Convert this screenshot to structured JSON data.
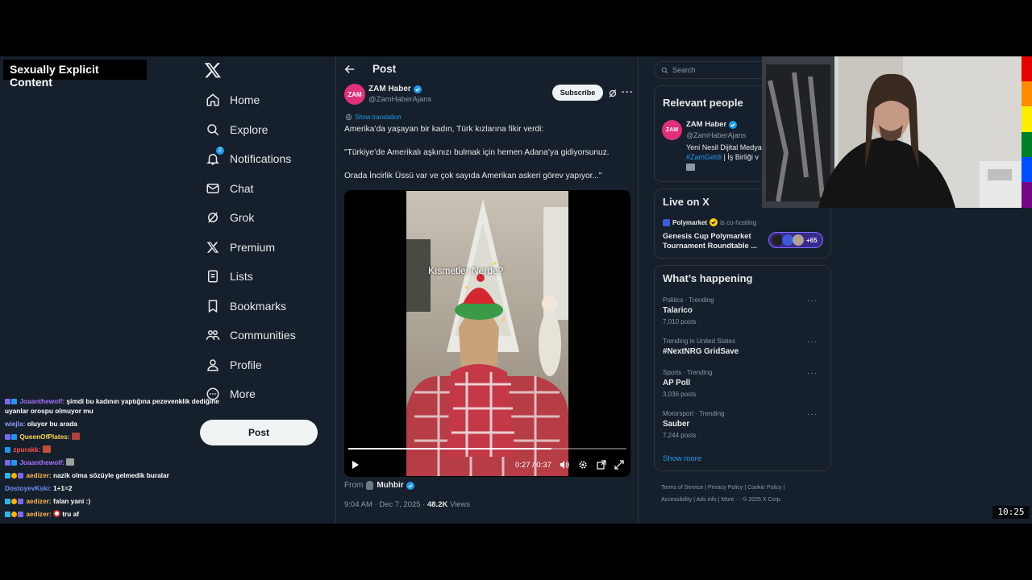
{
  "overlay": {
    "content_label": "Sexually Explicit Content"
  },
  "nav": {
    "items": [
      {
        "label": "Home",
        "icon": "home-icon"
      },
      {
        "label": "Explore",
        "icon": "search-icon"
      },
      {
        "label": "Notifications",
        "icon": "bell-icon",
        "badge": "2"
      },
      {
        "label": "Chat",
        "icon": "mail-icon"
      },
      {
        "label": "Grok",
        "icon": "grok-icon"
      },
      {
        "label": "Premium",
        "icon": "x-logo-icon"
      },
      {
        "label": "Lists",
        "icon": "list-icon"
      },
      {
        "label": "Bookmarks",
        "icon": "bookmark-icon"
      },
      {
        "label": "Communities",
        "icon": "communities-icon"
      },
      {
        "label": "Profile",
        "icon": "person-icon"
      },
      {
        "label": "More",
        "icon": "more-circle-icon"
      }
    ],
    "post_label": "Post"
  },
  "chat": [
    {
      "user": "Joaanthewolf:",
      "text": "şimdi bu kadının yaptığına pezevenklik dediğine uyanlar orospu olmuyor mu",
      "color": "#a970ff"
    },
    {
      "user": "wiejla:",
      "text": "oluyor bu arada",
      "color": "#8c9eff"
    },
    {
      "user": "QueenOfPlates:",
      "text": "",
      "color": "#ffd54f"
    },
    {
      "user": "zpurakk:",
      "text": "",
      "color": "#ff4d4d"
    },
    {
      "user": "Joaanthewolf:",
      "text": "",
      "color": "#a970ff"
    },
    {
      "user": "aedizer:",
      "text": "nazik olma sözüyle gelmedik buralar",
      "color": "#ffb74d"
    },
    {
      "user": "DostoyevKski:",
      "text": "1+1=2",
      "color": "#6f8dff"
    },
    {
      "user": "aedizer:",
      "text": "falan yani :)",
      "color": "#ffb74d"
    },
    {
      "user": "aedizer:",
      "text": "tru af",
      "color": "#ffb74d"
    }
  ],
  "post": {
    "header_title": "Post",
    "author_name": "ZAM Haber",
    "author_handle": "@ZamHaberAjans",
    "avatar_text": "ZAM",
    "subscribe_label": "Subscribe",
    "show_translation": "Show translation",
    "paragraphs": [
      "Amerika’da yaşayan bir kadın, Türk kızlarına  fikir verdi:",
      "\"Türkiye’de Amerikalı aşkınızı bulmak için hemen Adana’ya gidiyorsunuz.",
      "Orada İncirlik Üssü var ve çok sayıda Amerikan askeri görev yapıyor...\""
    ],
    "video": {
      "caption": "Kısmetler Nerde?",
      "time": "0:27 / 0:37",
      "progress": 0.73
    },
    "from_label": "From",
    "from_name": "Muhbir",
    "time": "9:04 AM · Dec 7, 2025 · ",
    "views_count": "48.2K",
    "views_label": " Views"
  },
  "right": {
    "search_placeholder": "Search",
    "relevant_title": "Relevant people",
    "person_name": "ZAM Haber",
    "person_handle": "@ZamHaberAjans",
    "person_bio": "Yeni Nesil Dijital Medya",
    "person_bio_tag": "#ZamGeldi",
    "person_bio_rest": " | İş Birliği v",
    "live_title": "Live on X",
    "live_host": "Polymarket",
    "live_host_suffix": "is co-hosting",
    "live_text": "Genesis Cup Polymarket Tournament Roundtable ...",
    "live_count": "+65",
    "happening_title": "What’s happening",
    "trends": [
      {
        "category": "Politics · Trending",
        "name": "Talarico",
        "posts": "7,010 posts"
      },
      {
        "category": "Trending in United States",
        "name": "#NextNRG GridSave",
        "posts": ""
      },
      {
        "category": "Sports · Trending",
        "name": "AP Poll",
        "posts": "3,036 posts"
      },
      {
        "category": "Motorsport · Trending",
        "name": "Sauber",
        "posts": "7,244 posts"
      }
    ],
    "show_more": "Show more",
    "footer_line1": "Terms of Service  |   Privacy Policy  |   Cookie Policy  |",
    "footer_line2": "Accessibility  |   Ads info  |   More ···   © 2025 X Corp."
  },
  "clock": "10:25"
}
